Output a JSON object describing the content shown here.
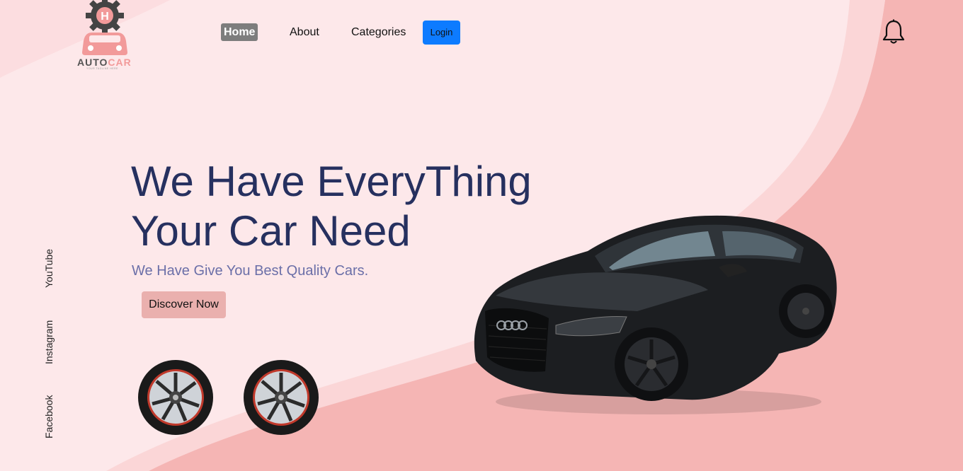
{
  "logo": {
    "text_auto": "AUTO",
    "text_car": "CAR",
    "tagline": "YOUR TAGLINE HERE",
    "icon": "gear-car-logo-icon"
  },
  "nav": {
    "items": [
      {
        "label": "Home",
        "active": true
      },
      {
        "label": "About"
      },
      {
        "label": "Categories"
      }
    ],
    "login_label": "Login"
  },
  "header": {
    "notification_icon": "bell-icon"
  },
  "hero": {
    "title_line1": "We Have EveryThing",
    "title_line2": "Your Car Need",
    "subtitle": "We Have Give You Best Quality Cars.",
    "cta_label": "Discover Now"
  },
  "social": {
    "links": [
      "YouTube",
      "Instagram",
      "Facebook"
    ]
  },
  "colors": {
    "background": "#fde8ea",
    "accent_pink": "#f2a9a8",
    "title": "#26305f",
    "subtitle": "#6b6fa8",
    "login_button": "#0d7bff",
    "home_active": "#7d7d7d",
    "cta": "#eab0ae"
  }
}
